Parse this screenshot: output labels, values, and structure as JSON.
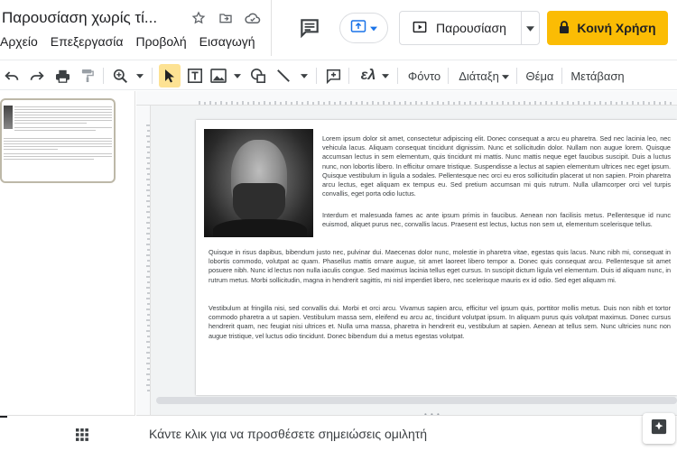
{
  "title": {
    "doc_title": "Παρουσίαση χωρίς τί...",
    "icons": [
      "star-icon",
      "move-to-folder-icon",
      "cloud-status-icon"
    ]
  },
  "menu": [
    "Αρχείο",
    "Επεξεργασία",
    "Προβολή",
    "Εισαγωγή"
  ],
  "header": {
    "present_label": "Παρουσίαση",
    "share_label": "Κοινή Χρήση",
    "share_color": "#fbbc04"
  },
  "toolbar": {
    "font_label": "Φόντο",
    "layout_label": "Διάταξη",
    "theme_label": "Θέμα",
    "transition_label": "Μετάβαση",
    "text_style_label": "ελ"
  },
  "slide": {
    "p1": "Lorem ipsum dolor sit amet, consectetur adipiscing elit. Donec consequat a arcu eu pharetra. Sed nec lacinia leo, nec vehicula lacus. Aliquam consequat tincidunt dignissim. Nunc et sollicitudin dolor. Nullam non augue lorem. Quisque accumsan lectus in sem elementum, quis tincidunt mi mattis. Nunc mattis neque eget faucibus suscipit. Duis a luctus nunc, non lobortis libero. In efficitur ornare tristique. Suspendisse a lectus at sapien elementum ultrices nec eget ipsum. Quisque vestibulum in ligula a sodales. Pellentesque nec orci eu eros sollicitudin placerat ut non sapien. Proin pharetra arcu lectus, eget aliquam ex tempus eu. Sed pretium accumsan mi quis rutrum. Nulla ullamcorper orci vel turpis convallis, eget porta odio luctus.",
    "p2": "Interdum et malesuada fames ac ante ipsum primis in faucibus. Aenean non facilisis metus. Pellentesque id nunc euismod, aliquet purus nec, convallis lacus. Praesent est lectus, luctus non sem ut, elementum scelerisque tellus.",
    "p3": "Quisque in risus dapibus, bibendum justo nec, pulvinar dui. Maecenas dolor nunc, molestie in pharetra vitae, egestas quis lacus. Nunc nibh mi, consequat in lobortis commodo, volutpat ac quam. Phasellus mattis ornare augue, sit amet laoreet libero tempor a. Donec quis consequat arcu. Pellentesque sit amet posuere nibh. Nunc id lectus non nulla iaculis congue. Sed maximus lacinia tellus eget cursus. In suscipit dictum ligula vel elementum. Duis id aliquam nunc, in rutrum metus. Morbi sollicitudin, magna in hendrerit sagittis, mi nisl imperdiet libero, nec scelerisque mauris ex id odio. Sed eget aliquam mi.",
    "p4": "Vestibulum at fringilla nisi, sed convallis dui. Morbi et orci arcu. Vivamus sapien arcu, efficitur vel ipsum quis, porttitor mollis metus. Duis non nibh et tortor commodo pharetra a ut sapien. Vestibulum massa sem, eleifend eu arcu ac, tincidunt volutpat ipsum. In aliquam purus quis volutpat maximus. Donec cursus hendrerit quam, nec feugiat nisi ultrices et. Nulla urna massa, pharetra in hendrerit eu, vestibulum at sapien. Aenean at tellus sem. Nunc ultricies nunc non augue tristique, vel luctus odio tincidunt. Donec bibendum dui a metus egestas volutpat."
  },
  "notes": {
    "placeholder": "Κάντε κλικ για να προσθέσετε σημειώσεις ομιλητή"
  }
}
